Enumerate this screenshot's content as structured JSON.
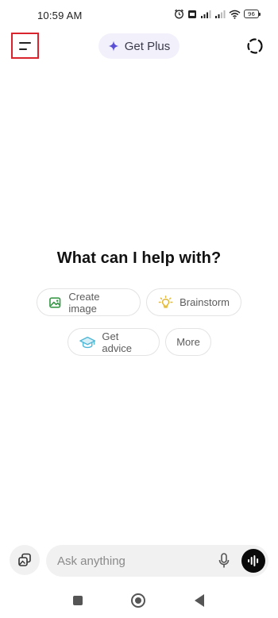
{
  "status_bar": {
    "time": "10:59 AM",
    "battery": "96",
    "icons": [
      "alarm-icon",
      "sim-icon",
      "signal-icon",
      "signal-icon",
      "wifi-icon",
      "battery-icon"
    ]
  },
  "top_bar": {
    "menu_icon": "menu-icon",
    "get_plus_label": "Get Plus",
    "sparkle_icon": "sparkle-icon",
    "temp_chat_icon": "temporary-chat-icon"
  },
  "main": {
    "headline": "What can I help with?",
    "suggestions": [
      {
        "label": "Create image",
        "icon": "image-icon",
        "color": "#3a9a4a"
      },
      {
        "label": "Brainstorm",
        "icon": "lightbulb-icon",
        "color": "#e2b93b"
      },
      {
        "label": "Get advice",
        "icon": "graduation-cap-icon",
        "color": "#4fb7d6"
      },
      {
        "label": "More",
        "icon": "",
        "color": "#5c5c5c"
      }
    ]
  },
  "composer": {
    "placeholder": "Ask anything",
    "attach_icon": "attach-image-icon",
    "mic_icon": "microphone-icon",
    "voice_icon": "voice-mode-icon"
  },
  "nav_bar": {
    "icons": [
      "recents-icon",
      "home-icon",
      "back-icon"
    ]
  },
  "colors": {
    "accent": "#5b4fd6",
    "plus_bg": "#f2f1fb",
    "highlight_border": "#d9232d"
  }
}
